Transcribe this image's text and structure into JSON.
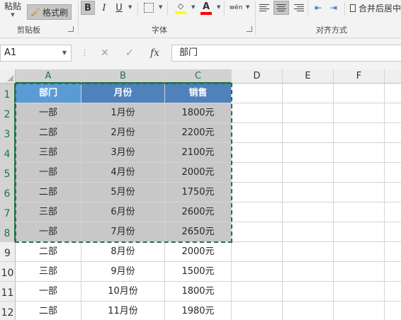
{
  "ribbon": {
    "paste_label": "粘贴",
    "format_painter_label": "格式刷",
    "clipboard_group": "剪贴板",
    "bold": "B",
    "italic": "I",
    "underline": "U",
    "fill_color": "#ffff00",
    "font_color": "#ff0000",
    "font_color_letter": "A",
    "phonetic_label": "wén",
    "font_group": "字体",
    "merge_label": "合并后居中",
    "alignment_group": "对齐方式"
  },
  "formula_bar": {
    "name_box": "A1",
    "cancel": "✕",
    "enter": "✓",
    "fx": "fx",
    "value": "部门"
  },
  "columns": [
    "A",
    "B",
    "C",
    "D",
    "E",
    "F"
  ],
  "rows": [
    {
      "num": "1",
      "a": "部门",
      "b": "月份",
      "c": "销售"
    },
    {
      "num": "2",
      "a": "一部",
      "b": "1月份",
      "c": "1800元"
    },
    {
      "num": "3",
      "a": "二部",
      "b": "2月份",
      "c": "2200元"
    },
    {
      "num": "4",
      "a": "三部",
      "b": "3月份",
      "c": "2100元"
    },
    {
      "num": "5",
      "a": "一部",
      "b": "4月份",
      "c": "2000元"
    },
    {
      "num": "6",
      "a": "二部",
      "b": "5月份",
      "c": "1750元"
    },
    {
      "num": "7",
      "a": "三部",
      "b": "6月份",
      "c": "2600元"
    },
    {
      "num": "8",
      "a": "一部",
      "b": "7月份",
      "c": "2650元"
    },
    {
      "num": "9",
      "a": "二部",
      "b": "8月份",
      "c": "2000元"
    },
    {
      "num": "10",
      "a": "三部",
      "b": "9月份",
      "c": "1500元"
    },
    {
      "num": "11",
      "a": "一部",
      "b": "10月份",
      "c": "1800元"
    },
    {
      "num": "12",
      "a": "二部",
      "b": "11月份",
      "c": "1980元"
    }
  ],
  "colors": {
    "header_a": "#5b9bd5",
    "header_bc": "#4f81bd",
    "selection_fill": "#c8c8c8",
    "marquee": "#217346"
  }
}
